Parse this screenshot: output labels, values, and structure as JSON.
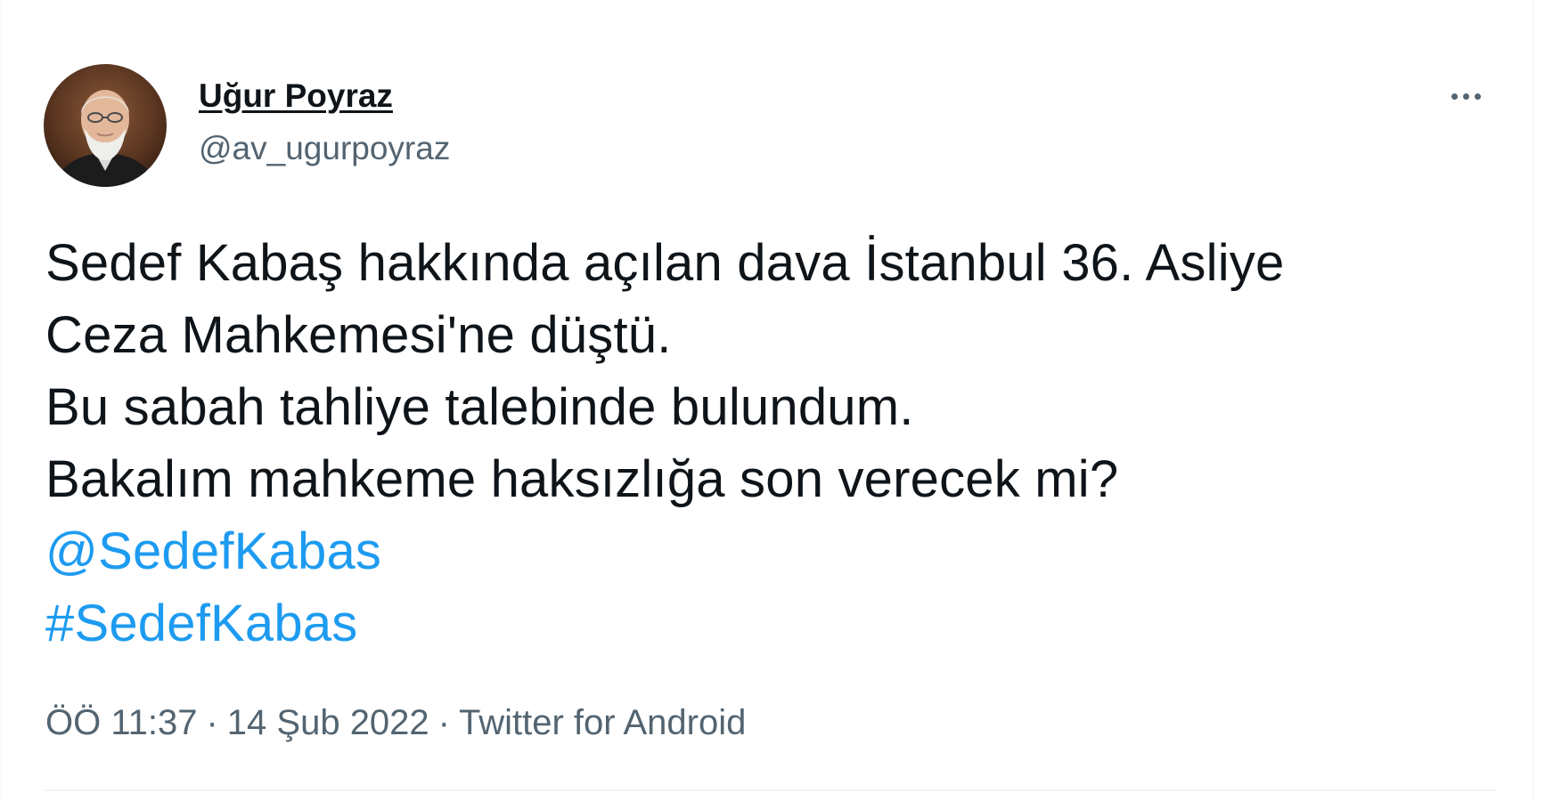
{
  "user": {
    "display_name": "Uğur Poyraz",
    "handle": "@av_ugurpoyraz"
  },
  "tweet": {
    "lines": [
      "Sedef Kabaş hakkında açılan dava İstanbul 36. Asliye",
      "Ceza Mahkemesi'ne düştü.",
      "Bu sabah tahliye talebinde bulundum.",
      "Bakalım mahkeme haksızlığa son verecek mi?"
    ],
    "mention": "@SedefKabas",
    "hashtag": "#SedefKabas"
  },
  "meta": {
    "time": "ÖÖ 11:37",
    "separator": "·",
    "date": "14 Şub 2022",
    "source": "Twitter for Android"
  },
  "icons": {
    "avatar": "profile-photo",
    "more": "more-options-icon"
  },
  "colors": {
    "text": "#0f1419",
    "secondary": "#536471",
    "link": "#1d9bf0",
    "border": "#eff3f4"
  }
}
